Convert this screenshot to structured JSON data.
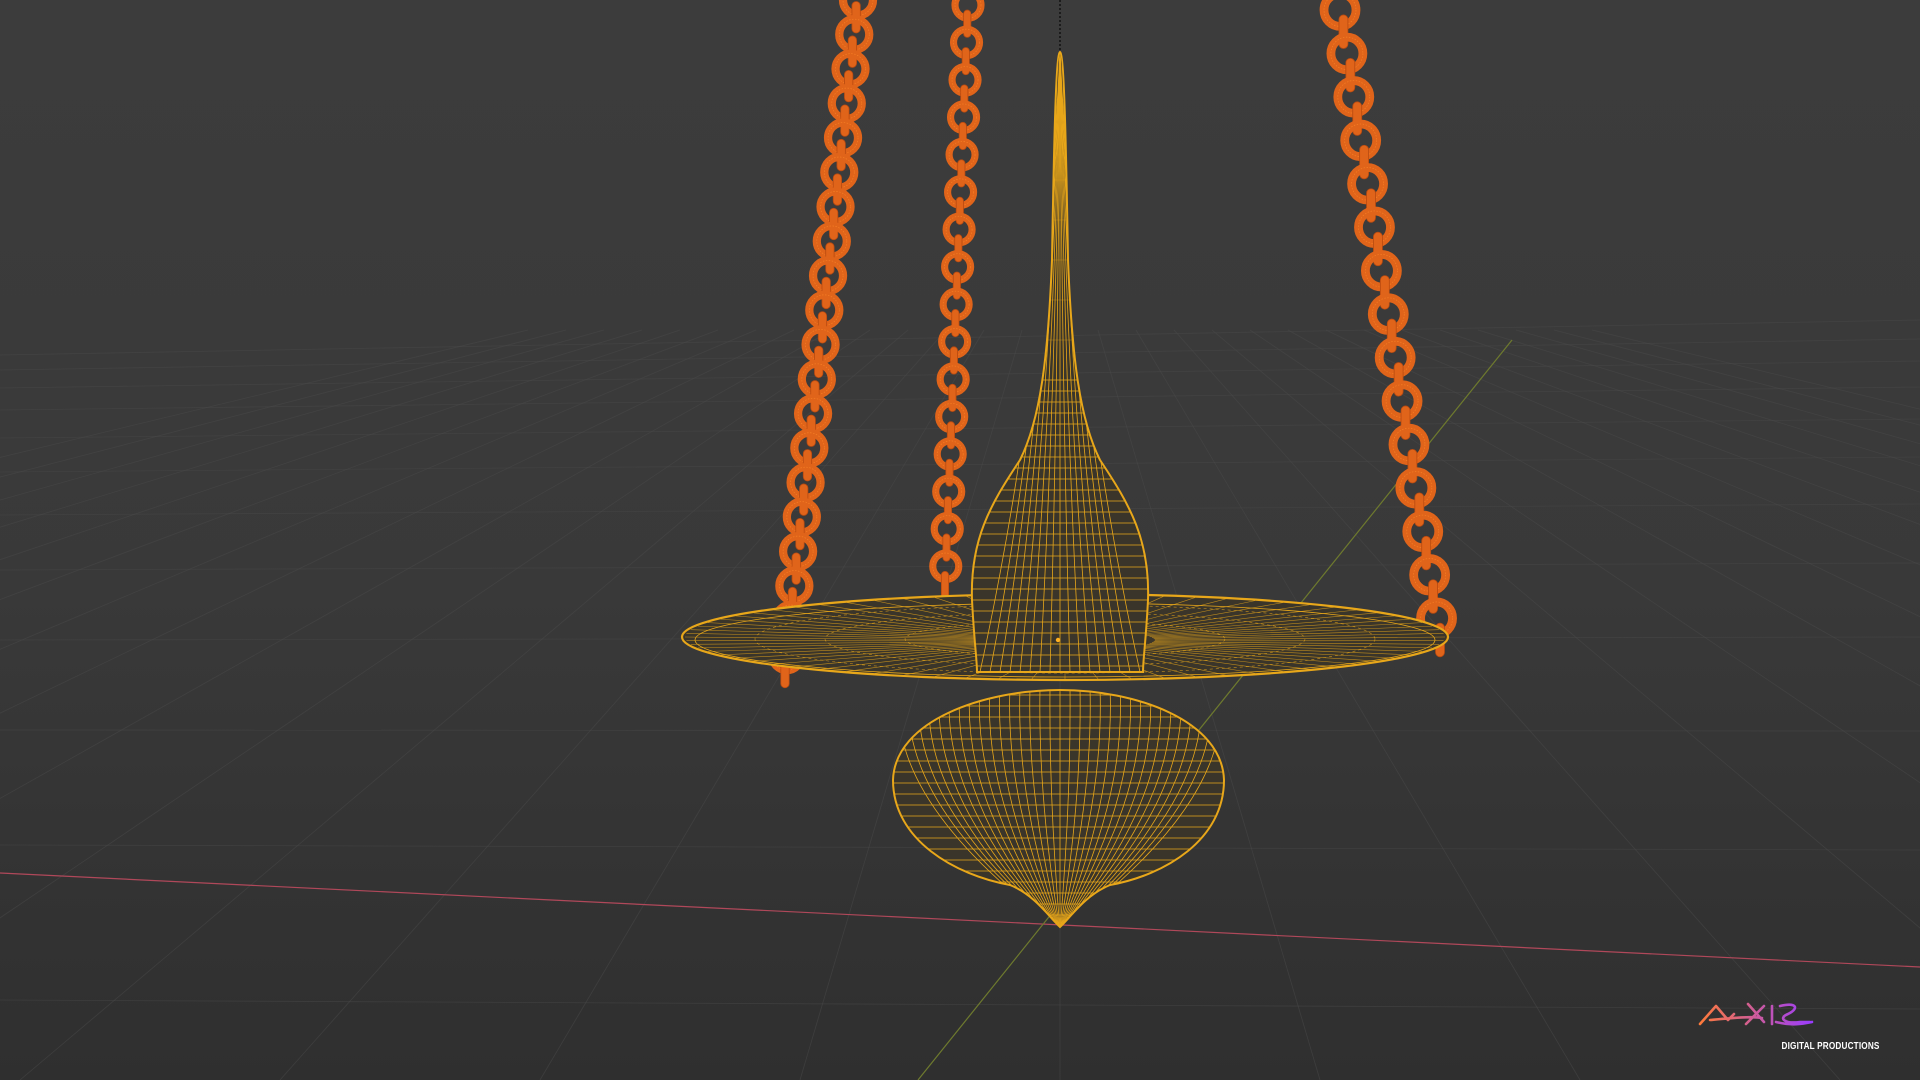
{
  "viewport": {
    "background": "#3a3a3a",
    "grid_color": "#4a4a4a",
    "x_axis_color": "#b0485a",
    "y_axis_color": "#6a7a2a"
  },
  "model": {
    "wire_color": "#e8a71a",
    "chain_color": "#e0641a",
    "chain_wire_color": "#ff8a2a"
  },
  "watermark": {
    "brand": "AXIS",
    "subtitle": "DIGITAL PRODUCTIONS",
    "gradient_start": "#ff7a3a",
    "gradient_end": "#9a3cff"
  }
}
